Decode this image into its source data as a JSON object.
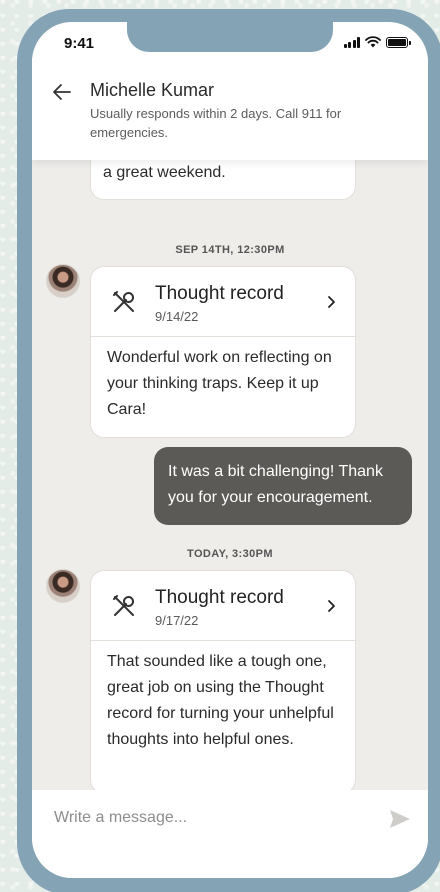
{
  "status_bar": {
    "time": "9:41"
  },
  "header": {
    "name": "Michelle Kumar",
    "subtitle": "Usually responds within 2 days. Call 911 for emergencies."
  },
  "messages": {
    "partial_text": "a great weekend.",
    "ts1": "SEP 14TH, 12:30PM",
    "record1": {
      "title": "Thought record",
      "date": "9/14/22",
      "body": "Wonderful work on reflecting on your thinking traps. Keep it up Cara!"
    },
    "reply1": "It was a bit challenging! Thank you for your encouragement.",
    "ts2": "TODAY, 3:30PM",
    "record2": {
      "title": "Thought record",
      "date": "9/17/22",
      "body": "That sounded like a tough one, great job on using the Thought record for turning your unhelpful thoughts into helpful ones."
    }
  },
  "composer": {
    "placeholder": "Write a message..."
  },
  "icons": {
    "back": "arrow-left-icon",
    "tool": "wrench-screwdriver-icon",
    "chevron": "chevron-right-icon",
    "send": "send-icon"
  },
  "colors": {
    "phone_frame": "#84a4b6",
    "screen_bg": "#efedea",
    "outgoing_bubble": "#5c5a56"
  }
}
